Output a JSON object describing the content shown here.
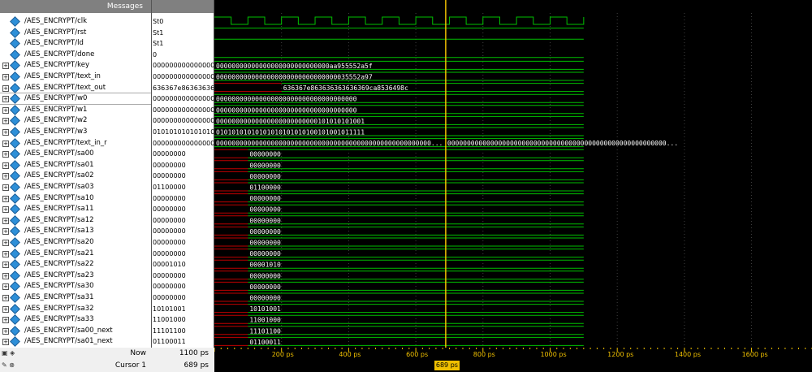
{
  "header": {
    "messages_label": "Messages"
  },
  "signals": [
    {
      "name": "/AES_ENCRYPT/clk",
      "value": "St0",
      "expandable": false
    },
    {
      "name": "/AES_ENCRYPT/rst",
      "value": "St1",
      "expandable": false
    },
    {
      "name": "/AES_ENCRYPT/ld",
      "value": "St1",
      "expandable": false
    },
    {
      "name": "/AES_ENCRYPT/done",
      "value": "0",
      "expandable": false
    },
    {
      "name": "/AES_ENCRYPT/key",
      "value": "000000000000000000",
      "expandable": true
    },
    {
      "name": "/AES_ENCRYPT/text_in",
      "value": "000000000000000000",
      "expandable": true
    },
    {
      "name": "/AES_ENCRYPT/text_out",
      "value": "636367e863636363",
      "expandable": true
    },
    {
      "name": "/AES_ENCRYPT/w0",
      "value": "000000000000000000",
      "expandable": true,
      "selected": true
    },
    {
      "name": "/AES_ENCRYPT/w1",
      "value": "000000000000000000",
      "expandable": true
    },
    {
      "name": "/AES_ENCRYPT/w2",
      "value": "000000000000000000",
      "expandable": true
    },
    {
      "name": "/AES_ENCRYPT/w3",
      "value": "010101010101010101",
      "expandable": true
    },
    {
      "name": "/AES_ENCRYPT/text_in_r",
      "value": "000000000000000000",
      "expandable": true
    },
    {
      "name": "/AES_ENCRYPT/sa00",
      "value": "00000000",
      "expandable": true
    },
    {
      "name": "/AES_ENCRYPT/sa01",
      "value": "00000000",
      "expandable": true
    },
    {
      "name": "/AES_ENCRYPT/sa02",
      "value": "00000000",
      "expandable": true
    },
    {
      "name": "/AES_ENCRYPT/sa03",
      "value": "01100000",
      "expandable": true
    },
    {
      "name": "/AES_ENCRYPT/sa10",
      "value": "00000000",
      "expandable": true
    },
    {
      "name": "/AES_ENCRYPT/sa11",
      "value": "00000000",
      "expandable": true
    },
    {
      "name": "/AES_ENCRYPT/sa12",
      "value": "00000000",
      "expandable": true
    },
    {
      "name": "/AES_ENCRYPT/sa13",
      "value": "00000000",
      "expandable": true
    },
    {
      "name": "/AES_ENCRYPT/sa20",
      "value": "00000000",
      "expandable": true
    },
    {
      "name": "/AES_ENCRYPT/sa21",
      "value": "00000000",
      "expandable": true
    },
    {
      "name": "/AES_ENCRYPT/sa22",
      "value": "00001010",
      "expandable": true
    },
    {
      "name": "/AES_ENCRYPT/sa23",
      "value": "00000000",
      "expandable": true
    },
    {
      "name": "/AES_ENCRYPT/sa30",
      "value": "00000000",
      "expandable": true
    },
    {
      "name": "/AES_ENCRYPT/sa31",
      "value": "00000000",
      "expandable": true
    },
    {
      "name": "/AES_ENCRYPT/sa32",
      "value": "10101001",
      "expandable": true
    },
    {
      "name": "/AES_ENCRYPT/sa33",
      "value": "11001000",
      "expandable": true
    },
    {
      "name": "/AES_ENCRYPT/sa00_next",
      "value": "11101100",
      "expandable": true
    },
    {
      "name": "/AES_ENCRYPT/sa01_next",
      "value": "01100011",
      "expandable": true
    }
  ],
  "waves": {
    "time_end_ps": 1100,
    "view_start_ps": 0,
    "view_end_ps": 1780,
    "clk_period_ps": 100,
    "bus_labels": {
      "key": "00000000000000000000000000000aa955552a5f",
      "text_in": "0000000000000000000000000000000035552a97",
      "text_out": "636367e863636363636369ca8536498c",
      "w0": "000000000000000000000000000000000000",
      "w1": "000000000000000000000000000000000000",
      "w2": "00000000000000000000000000101010101001",
      "w3": "01010101010101010101010100101001011111",
      "text_in_r": "0000000000000000000000000000000000000000000000000000000...",
      "text_in_r_2": "00000000000000000000000000000000000000000000000000000000...",
      "sa00": "00000000",
      "sa01": "00000000",
      "sa02": "00000000",
      "sa03": "01100000",
      "sa10": "00000000",
      "sa11": "00000000",
      "sa12": "00000000",
      "sa13": "00000000",
      "sa20": "00000000",
      "sa21": "00000000",
      "sa22": "00001010",
      "sa23": "00000000",
      "sa30": "00000000",
      "sa31": "00000000",
      "sa32": "10101001",
      "sa33": "11001000",
      "sa00_next": "11101100",
      "sa01_next": "01100011"
    },
    "colors": {
      "signal": "#00c000",
      "unknown": "#c00000",
      "cursor": "#f0c000",
      "grid": "#404040"
    }
  },
  "bottom": {
    "now_label": "Now",
    "now_value": "1100 ps",
    "cursor_label": "Cursor 1",
    "cursor_value": "689 ps",
    "cursor_flag": "689 ps",
    "cursor_ps": 689
  },
  "timeline": {
    "ticks": [
      "200 ps",
      "400 ps",
      "600 ps",
      "800 ps",
      "1000 ps",
      "1200 ps",
      "1400 ps",
      "1600 ps"
    ],
    "tick_values_ps": [
      200,
      400,
      600,
      800,
      1000,
      1200,
      1400,
      1600
    ]
  }
}
